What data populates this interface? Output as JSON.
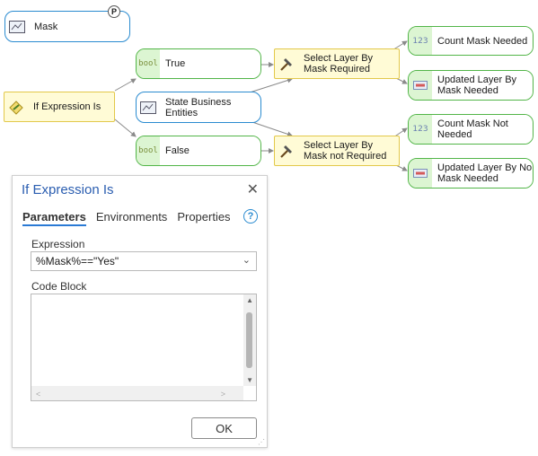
{
  "model": {
    "nodes": {
      "mask": "Mask",
      "mask_badge": "P",
      "if_expression": "If Expression Is",
      "true_label": "True",
      "true_type": "bool",
      "false_label": "False",
      "false_type": "bool",
      "state_business": "State Business Entities",
      "select_required": "Select Layer By Mask Required",
      "select_not_required": "Select Layer By Mask not Required",
      "count_needed": "Count Mask Needed",
      "count_needed_type": "123",
      "updated_by_mask": "Updated Layer By Mask Needed",
      "count_not_needed": "Count Mask Not Needed",
      "count_not_needed_type": "123",
      "updated_no_mask": "Updated Layer By No Mask Needed"
    }
  },
  "dialog": {
    "title": "If Expression Is",
    "close_glyph": "✕",
    "tabs": [
      "Parameters",
      "Environments",
      "Properties"
    ],
    "help_glyph": "?",
    "expression_label": "Expression",
    "expression_value": "%Mask%==\"Yes\"",
    "code_block_label": "Code Block",
    "code_block_value": "",
    "ok_label": "OK"
  },
  "colors": {
    "accent": "#2a8bd0",
    "variable_green": "#52b548",
    "tool_yellow": "#e2c84a",
    "title_blue": "#2a5db0"
  }
}
